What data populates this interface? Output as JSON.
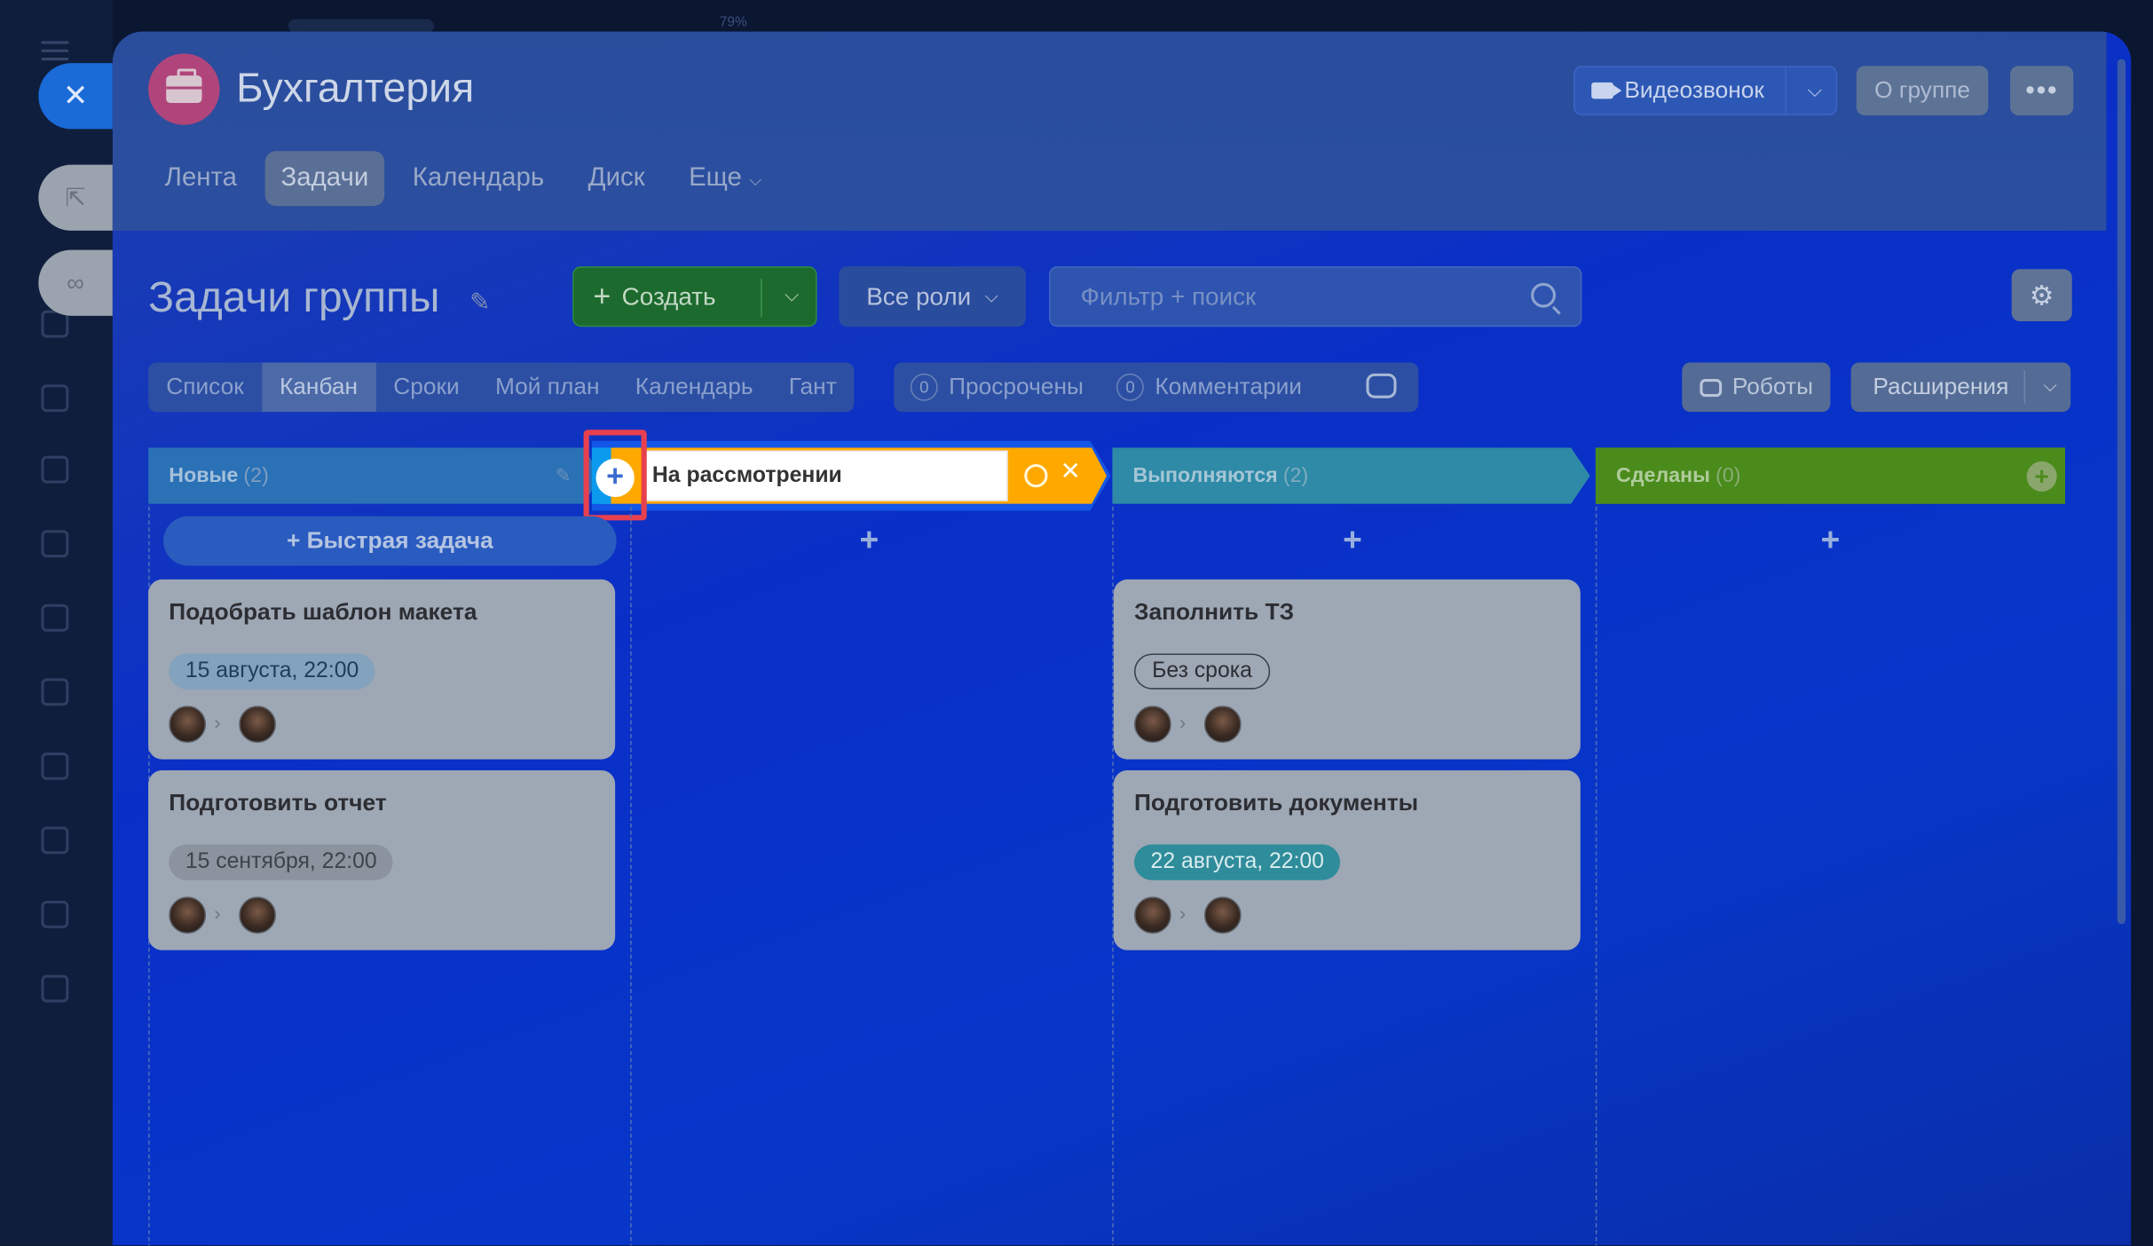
{
  "zoom_label": "79%",
  "header": {
    "group_title": "Бухгалтерия",
    "video_call": "Видеозвонок",
    "about_group": "О группе",
    "more": "•••",
    "tabs": [
      "Лента",
      "Задачи",
      "Календарь",
      "Диск",
      "Еще"
    ]
  },
  "toolbar": {
    "page_title": "Задачи группы",
    "create": "Создать",
    "roles": "Все роли",
    "search_placeholder": "Фильтр + поиск"
  },
  "views": {
    "tabs": [
      "Список",
      "Канбан",
      "Сроки",
      "Мой план",
      "Календарь",
      "Гант"
    ],
    "active": "Канбан",
    "overdue_count": "0",
    "overdue_label": "Просрочены",
    "comments_count": "0",
    "comments_label": "Комментарии",
    "robots": "Роботы",
    "extensions": "Расширения"
  },
  "kanban": {
    "columns": [
      {
        "name": "Новые",
        "count": "(2)",
        "color": "#2a71b6"
      },
      {
        "name": "На рассмотрении",
        "editing": true,
        "color": "#ffa900"
      },
      {
        "name": "Выполняются",
        "count": "(2)",
        "color": "#2e8aa7"
      },
      {
        "name": "Сделаны",
        "count": "(0)",
        "color": "#4a8b1c"
      }
    ],
    "quick_task": "+ Быстрая задача",
    "add_symbol": "+",
    "cards": [
      {
        "title": "Подобрать шаблон макета",
        "deadline": "15 августа, 22:00"
      },
      {
        "title": "Подготовить отчет",
        "deadline": "15 сентября, 22:00"
      },
      {
        "title": "Заполнить ТЗ",
        "deadline": "Без срока"
      },
      {
        "title": "Подготовить документы",
        "deadline": "22 августа, 22:00"
      }
    ]
  },
  "icons": {
    "close": "✕",
    "chevron": "⌵",
    "pin": "✎",
    "gear": "⚙",
    "pencil": "✎",
    "arrow": "›"
  }
}
